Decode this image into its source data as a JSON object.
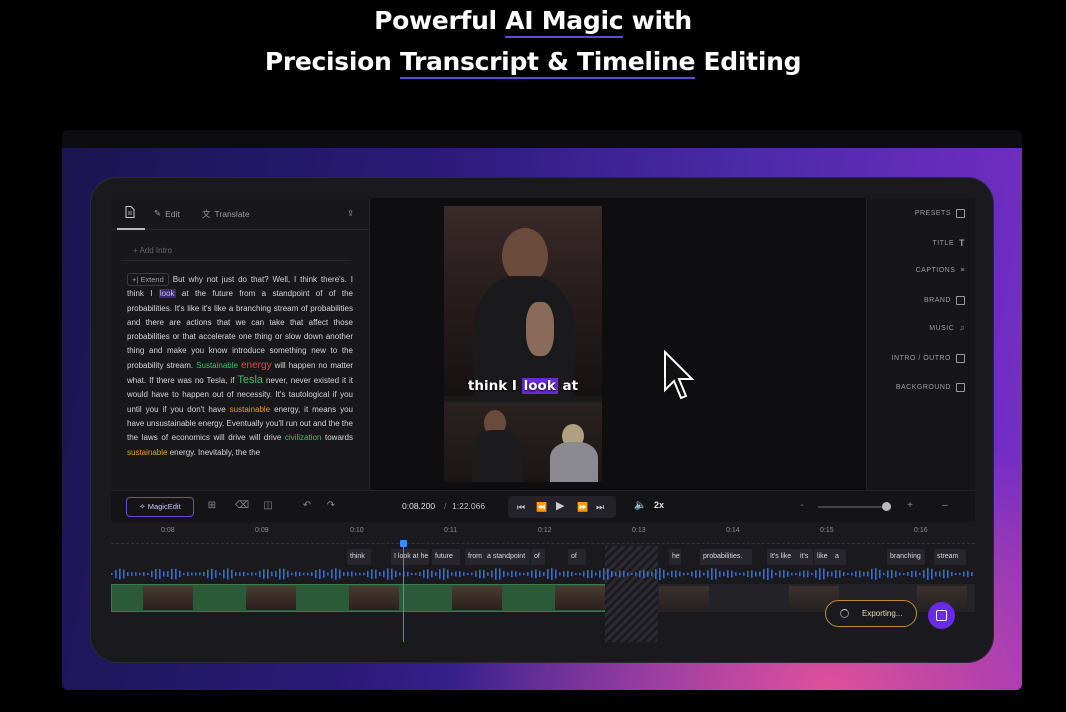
{
  "headline": {
    "line1_pre": "Powerful ",
    "line1_hl": "AI Magic",
    "line1_post": " with",
    "line2_pre": "Precision ",
    "line2_hl": "Transcript & Timeline",
    "line2_post": " Editing"
  },
  "editor": {
    "tabs": {
      "edit": "Edit",
      "translate": "Translate"
    },
    "add_intro": "+ Add Intro",
    "extend_label": "+| Extend",
    "transcript": {
      "p1": "But why not just do that? Well, I think there's. I think I ",
      "look": "look",
      "p2": " at the future from a standpoint of of the probabilities. It's like it's like a branching stream of probabilities and there are actions that we can take that affect those probabilities or that accelerate one thing or slow down another thing and make you know introduce something new to the probability stream. ",
      "sustainable1": "Sustainable",
      "energy1": "energy",
      "p3": " will happen no matter what. If there was no Tesla, if ",
      "tesla": "Tesla",
      "p4": " never, never existed it it would have to happen out of necessity. It's tautological if you until you if you don't have ",
      "sustainable2": "sustainable",
      "p5": " energy, it means you have unsustainable energy. Eventually you'll run out and the the the laws of economics will drive will drive ",
      "civilization": "civilization",
      "p6": " towards ",
      "sustainable3": "sustainable",
      "p7": " energy. Inevitably, the the"
    },
    "caption": {
      "pre": "think I ",
      "hl": "look",
      "post": " at"
    },
    "right_panel": [
      "PRESETS",
      "TITLE",
      "CAPTIONS",
      "BRAND",
      "MUSIC",
      "INTRO / OUTRO",
      "BACKGROUND"
    ],
    "toolbar": {
      "magic_edit": "MagicEdit",
      "time_current": "0:08.200",
      "time_separator": "/",
      "time_total": "1:22.066",
      "speed": "2x"
    },
    "timeline": {
      "ticks": [
        "0:08",
        "0:09",
        "0:10",
        "0:11",
        "0:12",
        "0:13",
        "0:14",
        "0:15",
        "0:16"
      ],
      "words": [
        "think",
        "I look at he",
        "future",
        "from",
        "a standpoint",
        "of",
        "of",
        "he",
        "probabilities.",
        "It's like",
        "it's",
        "like",
        "a",
        "branching",
        "stream"
      ]
    },
    "export_label": "Exporting..."
  }
}
